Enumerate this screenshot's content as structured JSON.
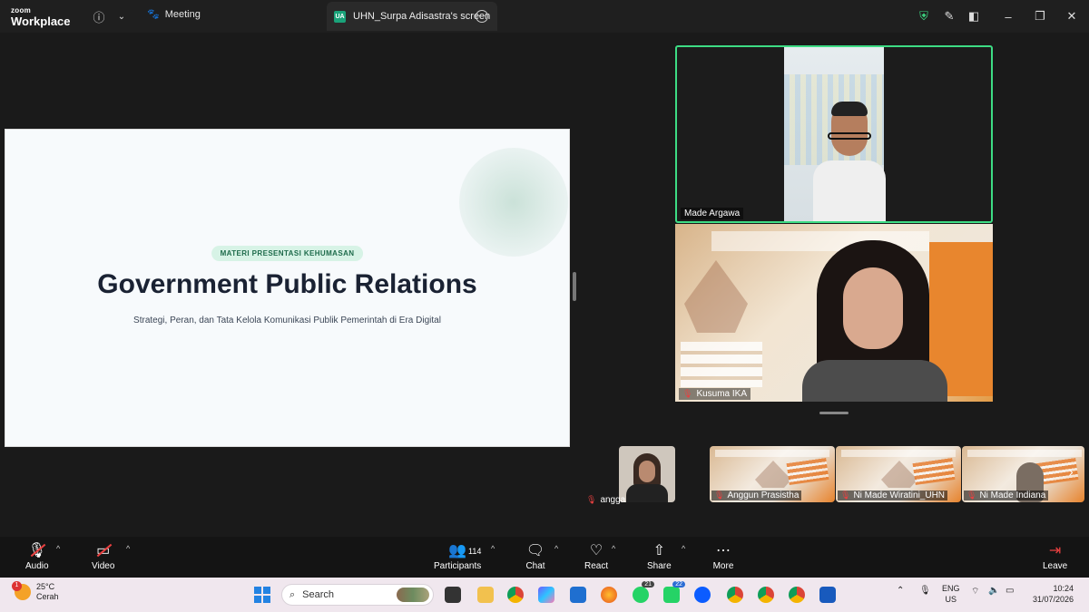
{
  "app": {
    "logo_line1": "zoom",
    "logo_line2": "Workplace",
    "meeting_tab": "Meeting",
    "share_tab": "UHN_Surpa Adisastra's screen",
    "share_badge": "UA"
  },
  "slide": {
    "pill": "MATERI PRESENTASI KEHUMASAN",
    "title": "Government Public Relations",
    "subtitle": "Strategi, Peran, dan Tata Kelola Komunikasi Publik Pemerintah di Era Digital"
  },
  "participants_video": [
    {
      "name": "Made Argawa",
      "muted": false
    },
    {
      "name": "Kusuma IKA",
      "muted": true
    }
  ],
  "thumbnails": [
    {
      "name": "angga",
      "muted": true
    },
    {
      "name": "Anggun Prasistha",
      "muted": true
    },
    {
      "name": "Ni Made Wiratini_UHN",
      "muted": true
    },
    {
      "name": "Ni Made Indiana",
      "muted": true
    }
  ],
  "controls": {
    "audio": "Audio",
    "video": "Video",
    "participants": "Participants",
    "participants_count": "114",
    "chat": "Chat",
    "react": "React",
    "share": "Share",
    "more": "More",
    "leave": "Leave"
  },
  "taskbar": {
    "temperature": "25°C",
    "condition": "Cerah",
    "weather_badge": "1",
    "search_placeholder": "Search",
    "whatsapp_badge": "21",
    "whatsapp2_badge": "22",
    "lang_line1": "ENG",
    "lang_line2": "US",
    "time": "10:24",
    "date": "31/07/2026"
  },
  "colors": {
    "active_speaker": "#3ddc84",
    "muted": "#e84040",
    "accent_green": "#1aa37a"
  }
}
